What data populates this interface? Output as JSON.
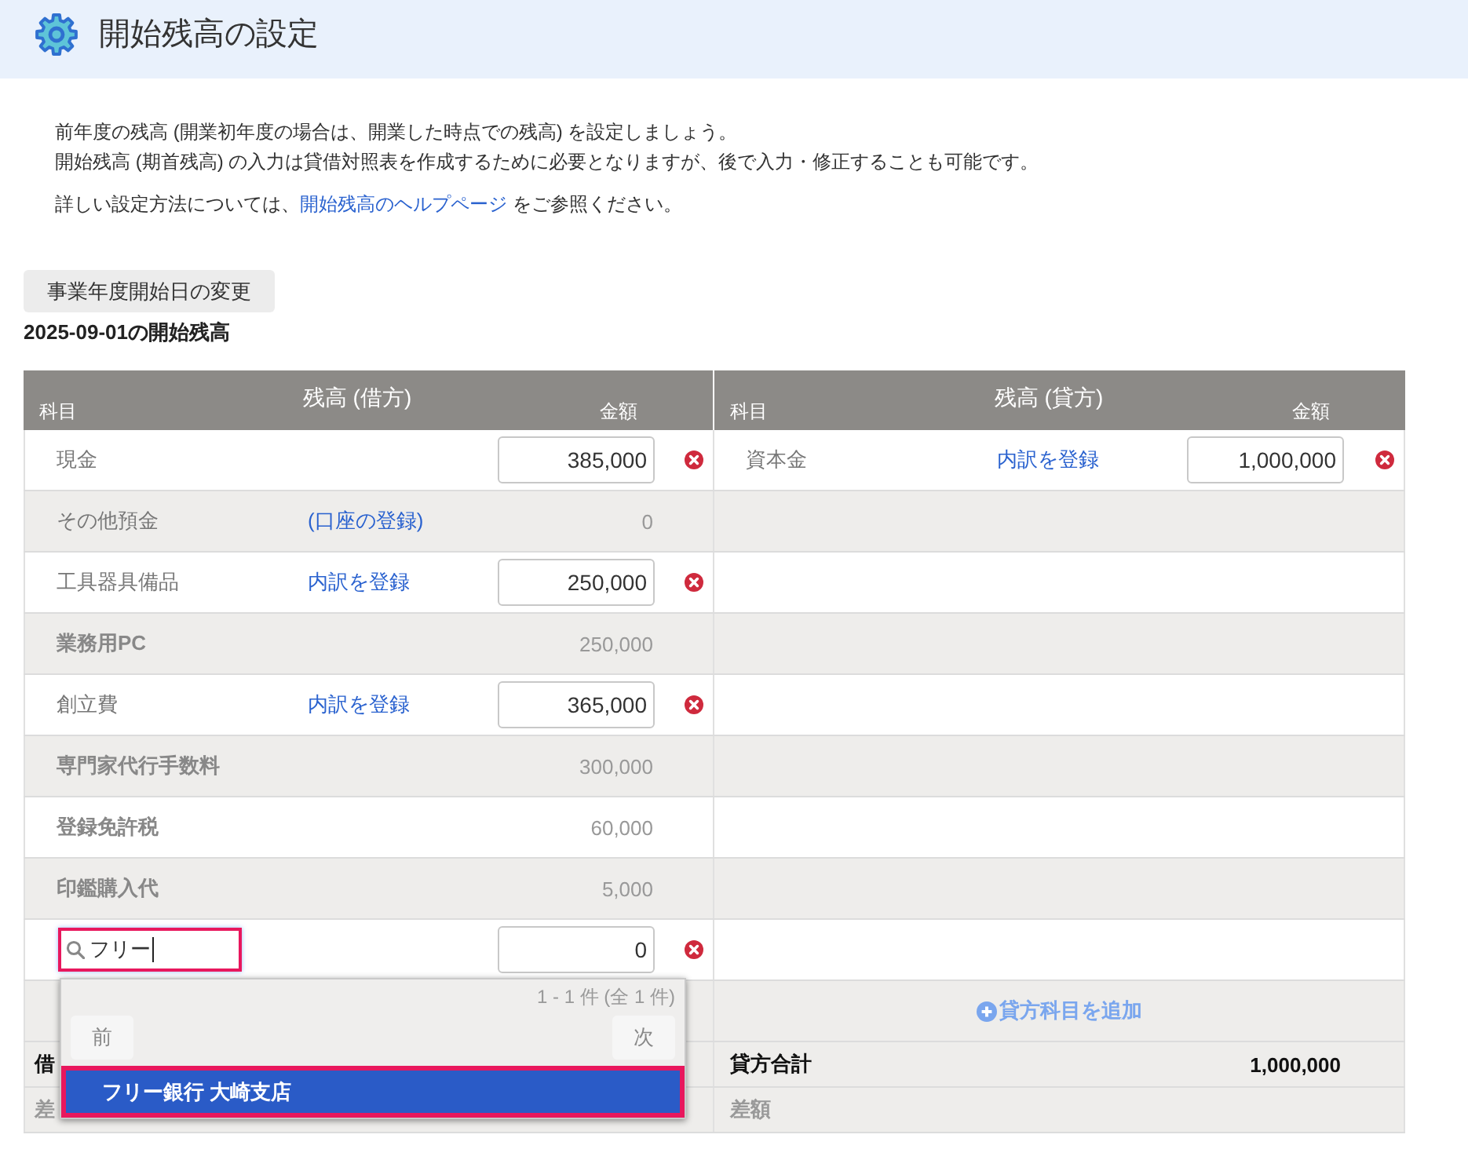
{
  "header": {
    "title": "開始残高の設定"
  },
  "intro": {
    "lines": [
      "前年度の残高 (開業初年度の場合は、開業した時点での残高) を設定しましょう。",
      "開始残高 (期首残高) の入力は貸借対照表を作成するために必要となりますが、後で入力・修正することも可能です。"
    ],
    "help": {
      "before": "詳しい設定方法については、",
      "link": "開始残高のヘルプページ",
      "after": " をご参照ください。"
    }
  },
  "change_start_date_button": "事業年度開始日の変更",
  "balance_title": "2025-09-01の開始残高",
  "table": {
    "debit_header": {
      "account": "科目",
      "title": "残高 (借方)",
      "amount": "金額"
    },
    "credit_header": {
      "account": "科目",
      "title": "残高 (貸方)",
      "amount": "金額"
    },
    "rows": [
      {
        "debit": {
          "kind": "account",
          "name": "現金",
          "amount": "385,000"
        },
        "credit": {
          "kind": "account",
          "name": "資本金",
          "link": "内訳を登録",
          "amount": "1,000,000"
        }
      },
      {
        "debit": {
          "kind": "bank_group",
          "name": "その他預金",
          "link": "(口座の登録)",
          "amount": "0"
        }
      },
      {
        "debit": {
          "kind": "account",
          "name": "工具器具備品",
          "link": "内訳を登録",
          "amount": "250,000"
        }
      },
      {
        "debit": {
          "kind": "detail",
          "name": "業務用PC",
          "amount": "250,000"
        }
      },
      {
        "debit": {
          "kind": "account",
          "name": "創立費",
          "link": "内訳を登録",
          "amount": "365,000"
        }
      },
      {
        "debit": {
          "kind": "detail",
          "name": "専門家代行手数料",
          "amount": "300,000"
        }
      },
      {
        "debit": {
          "kind": "detail",
          "name": "登録免許税",
          "amount": "60,000"
        }
      },
      {
        "debit": {
          "kind": "detail",
          "name": "印鑑購入代",
          "amount": "5,000"
        }
      },
      {
        "debit": {
          "kind": "search",
          "query": "フリー",
          "focused": true,
          "amount": "0",
          "dropdown": {
            "count": "1 - 1 件 (全 1 件)",
            "prev": "前",
            "next": "次",
            "options": [
              {
                "label": "フリー銀行 大崎支店",
                "selected": true
              }
            ]
          }
        }
      }
    ],
    "add_credit": "貸方科目を追加",
    "totals": [
      {
        "kind": "sum",
        "debit_label": "借",
        "credit_label": "貸方合計",
        "credit_amount": "1,000,000"
      },
      {
        "kind": "difference",
        "debit_label": "差",
        "credit_label": "差額"
      }
    ]
  }
}
